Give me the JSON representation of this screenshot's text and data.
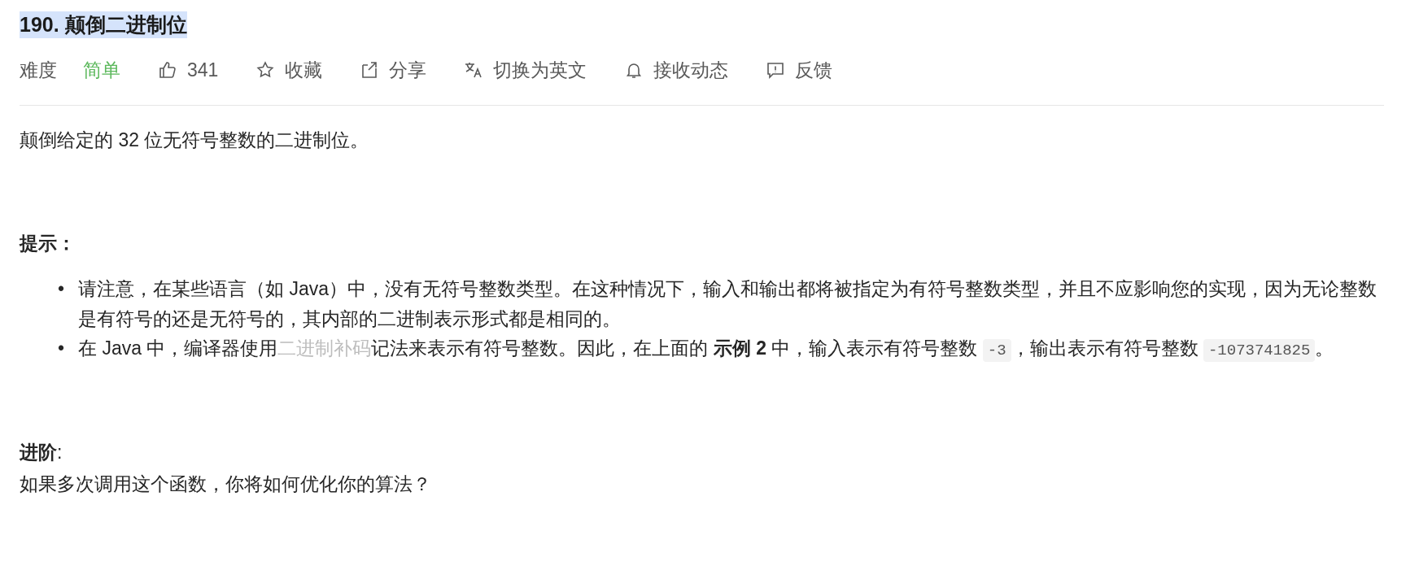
{
  "title": {
    "text": "190. 颠倒二进制位",
    "highlighted": true
  },
  "toolbar": [
    {
      "kind": "difficulty",
      "label": "难度",
      "value": "简单"
    },
    {
      "kind": "action",
      "label": "341"
    },
    {
      "kind": "action",
      "label": "收藏"
    },
    {
      "kind": "action",
      "label": "分享"
    },
    {
      "kind": "action",
      "label": "切换为英文"
    },
    {
      "kind": "action",
      "label": "接收动态"
    },
    {
      "kind": "action",
      "label": "反馈"
    }
  ],
  "description": "颠倒给定的 32 位无符号整数的二进制位。",
  "hint_heading": "提示：",
  "hints": [
    {
      "marker": "•",
      "segments": [
        {
          "kind": "text",
          "text": "请注意，在某些语言（如 Java）中，没有无符号整数类型。在这种情况下，输入和输出都将被指定为有符号整数类型，并且不应影响您的实现，因为无论整数是有符号的还是无符号的，其内部的二进制表示形式都是相同的。"
        }
      ]
    },
    {
      "marker": "•",
      "segments": [
        {
          "kind": "text",
          "text": "在 Java 中，编译器使用"
        },
        {
          "kind": "link",
          "text": "二进制补码"
        },
        {
          "kind": "text",
          "text": "记法来表示有符号整数。因此，在上面的 **示例 2** 中，输入表示有符号整数 "
        },
        {
          "kind": "code",
          "text": "-3"
        },
        {
          "kind": "text",
          "text": "，输出表示有符号整数 "
        },
        {
          "kind": "code",
          "text": "-1073741825"
        },
        {
          "kind": "text",
          "text": "。"
        }
      ]
    }
  ],
  "advanced_heading": "进阶",
  "advanced_colon": ":",
  "advanced_text": "如果多次调用这个函数，你将如何优化你的算法？"
}
